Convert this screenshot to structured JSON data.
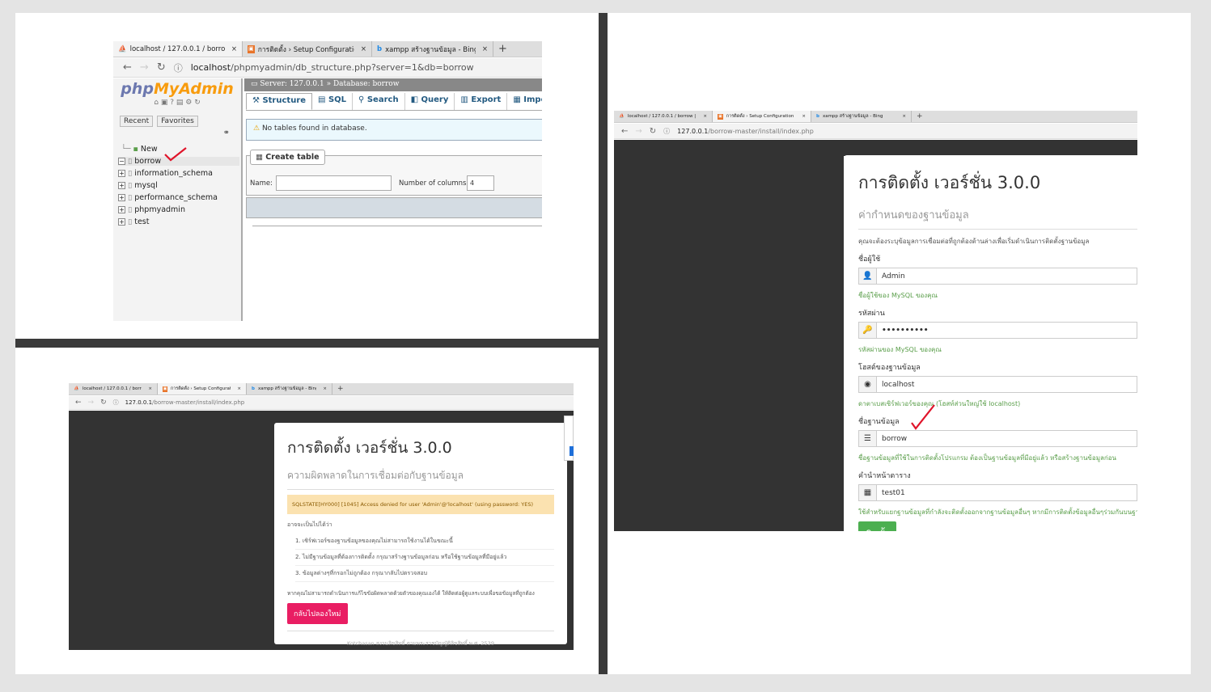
{
  "pma": {
    "tabs": [
      {
        "label": "localhost / 127.0.0.1 / borrow | p",
        "close": "×"
      },
      {
        "label": "การติดตั้ง › Setup Configuration F",
        "close": "×"
      },
      {
        "label": "xampp สร้างฐานข้อมูล - Bing",
        "close": "×"
      }
    ],
    "new_tab": "+",
    "nav": {
      "back": "←",
      "forward": "→",
      "reload": "↻",
      "info": "ⓘ"
    },
    "url_host": "localhost",
    "url_path": "/phpmyadmin/db_structure.php?server=1&db=borrow",
    "logo_php": "php",
    "logo_myadmin": "MyAdmin",
    "recent_btn": "Recent",
    "favorites_btn": "Favorites",
    "link_icon": "⚭",
    "tree": [
      "New",
      "borrow",
      "information_schema",
      "mysql",
      "performance_schema",
      "phpmyadmin",
      "test"
    ],
    "breadcrumb": "Server: 127.0.0.1 » Database: borrow",
    "menu": [
      "Structure",
      "SQL",
      "Search",
      "Query",
      "Export",
      "Import"
    ],
    "notice": "No tables found in database.",
    "create_table": "Create table",
    "name_label": "Name:",
    "name_value": "",
    "columns_label": "Number of columns:",
    "columns_value": "4"
  },
  "error_window": {
    "tabs": [
      {
        "label": "localhost / 127.0.0.1 / borrow | p",
        "close": "×"
      },
      {
        "label": "การติดตั้ง › Setup Configuration F",
        "close": "×"
      },
      {
        "label": "xampp สร้างฐานข้อมูล - Bing",
        "close": "×"
      }
    ],
    "new_tab": "+",
    "url_host": "127.0.0.1",
    "url_path": "/borrow-master/install/index.php",
    "title": "การติดตั้ง เวอร์ชั่น 3.0.0",
    "subtitle": "ความผิดพลาดในการเชื่อมต่อกับฐานข้อมูล",
    "error": "SQLSTATE[HY000] [1045] Access denied for user 'Admin'@'localhost' (using password: YES)",
    "maybe": "อาจจะเป็นไปได้ว่า",
    "reasons": [
      "1. เซิร์ฟเวอร์ของฐานข้อมูลของคุณไม่สามารถใช้งานได้ในขณะนี้",
      "2. ไม่มีฐานข้อมูลที่ต้องการติดตั้ง กรุณาสร้างฐานข้อมูลก่อน หรือใช้ฐานข้อมูลที่มีอยู่แล้ว",
      "3. ข้อมูลต่างๆที่กรอกไม่ถูกต้อง กรุณากลับไปตรวจสอบ"
    ],
    "help": "หากคุณไม่สามารถดำเนินการแก้ไขข้อผิดพลาดด้วยตัวของคุณเองได้ ให้ติดต่อผู้ดูแลระบบเพื่อขอข้อมูลที่ถูกต้อง",
    "retry_button": "กลับไปลองใหม่",
    "footer": "Kotchasan สงวนลิขสิทธิ์ ตามพระราชบัญญัติลิขสิทธิ์ พ.ศ. 2539"
  },
  "install_window": {
    "tabs": [
      {
        "label": "localhost / 127.0.0.1 / borrow | p",
        "close": "×"
      },
      {
        "label": "การติดตั้ง › Setup Configuration F",
        "close": "×"
      },
      {
        "label": "xampp สร้างฐานข้อมูล - Bing",
        "close": "×"
      }
    ],
    "new_tab": "+",
    "url_host": "127.0.0.1",
    "url_path": "/borrow-master/install/index.php",
    "title": "การติดตั้ง เวอร์ชั่น 3.0.0",
    "subtitle": "ค่ากำหนดของฐานข้อมูล",
    "intro": "คุณจะต้องระบุข้อมูลการเชื่อมต่อที่ถูกต้องด้านล่างเพื่อเริ่มดำเนินการติดตั้งฐานข้อมูล",
    "fields": [
      {
        "label": "ชื่อผู้ใช้",
        "value": "Admin",
        "hint": "ชื่อผู้ใช้ของ MySQL ของคุณ",
        "icon": "user-icon"
      },
      {
        "label": "รหัสผ่าน",
        "value": "••••••••••",
        "hint": "รหัสผ่านของ MySQL ของคุณ",
        "icon": "key-icon"
      },
      {
        "label": "โฮสต์ของฐานข้อมูล",
        "value": "localhost",
        "hint": "ดาตาเบสเซิร์ฟเวอร์ของคุณ (โฮสท์ส่วนใหญ่ใช้ localhost)",
        "icon": "globe-icon"
      },
      {
        "label": "ชื่อฐานข้อมูล",
        "value": "borrow",
        "hint": "ชื่อฐานข้อมูลที่ใช้ในการติดตั้งโปรแกรม ต้องเป็นฐานข้อมูลที่มีอยู่แล้ว หรือสร้างฐานข้อมูลก่อน",
        "icon": "database-icon"
      },
      {
        "label": "คำนำหน้าตาราง",
        "value": "test01",
        "hint": "ใช้สำหรับแยกฐานข้อมูลที่กำลังจะติดตั้งออกจากฐานข้อมูลอื่นๆ หากมีการติดตั้งข้อมูลอื่นๆร่วมกันบนฐานข้อมูลนี้",
        "icon": "table-icon"
      }
    ],
    "install_button": "ติดตั้ง"
  },
  "colors": {
    "accent_pink": "#e91e63",
    "install_green": "#4caf50",
    "hint_green": "#5a9e4a",
    "error_bg": "#fbe2b0",
    "checkmark": "#e0142a"
  }
}
